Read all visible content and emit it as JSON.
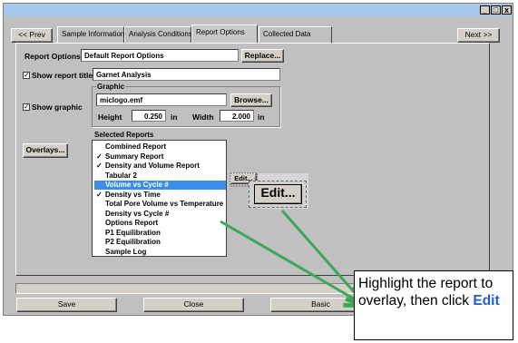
{
  "window": {
    "controls": {
      "minimize": "_",
      "maximize": "□",
      "close": "x"
    }
  },
  "nav": {
    "prev": "<< Prev",
    "next": "Next >>"
  },
  "tabs": [
    {
      "label": "Sample Information"
    },
    {
      "label": "Analysis Conditions"
    },
    {
      "label": "Report Options"
    },
    {
      "label": "Collected Data"
    }
  ],
  "report_options": {
    "label": "Report Options",
    "value": "Default Report Options",
    "replace_button": "Replace..."
  },
  "show_report_title": {
    "label": "Show report title",
    "checked": true,
    "value": "Garnet Analysis"
  },
  "show_graphic": {
    "label": "Show graphic",
    "checked": true,
    "group_label": "Graphic",
    "file": "miclogo.emf",
    "browse_button": "Browse...",
    "height_label": "Height",
    "height_value": "0.250",
    "height_unit": "in",
    "width_label": "Width",
    "width_value": "2.000",
    "width_unit": "in"
  },
  "overlays_button": "Overlays...",
  "selected_reports": {
    "label": "Selected Reports",
    "items": [
      {
        "label": "Combined Report",
        "checked": false,
        "selected": false
      },
      {
        "label": "Summary Report",
        "checked": true,
        "selected": false
      },
      {
        "label": "Density and Volume Report",
        "checked": true,
        "selected": false
      },
      {
        "label": "Tabular 2",
        "checked": false,
        "selected": false
      },
      {
        "label": "Volume vs Cycle #",
        "checked": false,
        "selected": true
      },
      {
        "label": "Density vs Time",
        "checked": true,
        "selected": false
      },
      {
        "label": "Total Pore Volume vs Temperature",
        "checked": false,
        "selected": false
      },
      {
        "label": "Density vs Cycle #",
        "checked": false,
        "selected": false
      },
      {
        "label": "Options Report",
        "checked": false,
        "selected": false
      },
      {
        "label": "P1 Equilibration",
        "checked": false,
        "selected": false
      },
      {
        "label": "P2 Equilibration",
        "checked": false,
        "selected": false
      },
      {
        "label": "Sample Log",
        "checked": false,
        "selected": false
      }
    ]
  },
  "edit_button": "Edit...",
  "edit_button_zoom": "Edit...",
  "bottom_buttons": {
    "save": "Save",
    "close": "Close",
    "basic": "Basic"
  },
  "callout": {
    "text_before": "Highlight the report to overlay, then click",
    "highlight": "Edit"
  },
  "colors": {
    "window_bg": "#c0c0c0",
    "selection": "#3a8ee6",
    "arrow": "#3aa857",
    "titlebar": "#a6c8ea"
  }
}
